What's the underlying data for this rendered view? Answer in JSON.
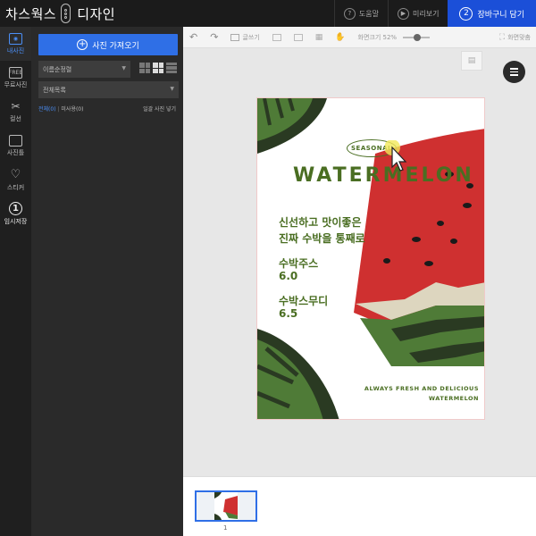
{
  "header": {
    "logo_left": "차스웍스",
    "logo_right": "디자인",
    "buttons": [
      {
        "label": "도움말",
        "icon": "question-icon"
      },
      {
        "label": "미리보기",
        "icon": "play-icon"
      }
    ],
    "cart": {
      "badge": "2",
      "label": "장바구니 담기"
    }
  },
  "iconbar": {
    "items": [
      {
        "label": "내사진",
        "icon": "photo-icon",
        "active": true
      },
      {
        "label": "무료사진",
        "icon": "free-photo-icon",
        "badge": "FREE"
      },
      {
        "label": "컬선",
        "icon": "scissors-icon"
      },
      {
        "label": "사진틀",
        "icon": "frame-icon"
      },
      {
        "label": "스티커",
        "icon": "heart-icon"
      },
      {
        "label": "임시저장",
        "icon": "save-icon",
        "badge": "1"
      }
    ]
  },
  "panel": {
    "import_label": "사진 가져오기",
    "sort_value": "이름순정렬",
    "folder_value": "전체목록",
    "tab_all": "전체(0)",
    "tab_unused": "미사용(0)",
    "bulk_insert": "일괄 사진 넣기"
  },
  "toolbar": {
    "text_tool": "글쓰기",
    "zoom_label": "화면크기 52%",
    "zoom_value": 0.52,
    "fit_label": "화면맞춤"
  },
  "design": {
    "badge": "SEASONAL",
    "title": "WATERMELON",
    "tagline_1": "신선하고 맛이좋은",
    "tagline_2": "진짜 수박을 통째로",
    "item1_name": "수박주스",
    "item1_price": "6.0",
    "item2_name": "수박스무디",
    "item2_price": "6.5",
    "footer_1": "ALWAYS FRESH AND DELICIOUS",
    "footer_2": "WATERMELON",
    "colors": {
      "rind_dark": "#2a3a22",
      "rind_green": "#4f7b37",
      "flesh": "#cf3030",
      "pith": "#ddd6bf",
      "text": "#4a6e22"
    }
  },
  "pages": {
    "number": "1"
  }
}
